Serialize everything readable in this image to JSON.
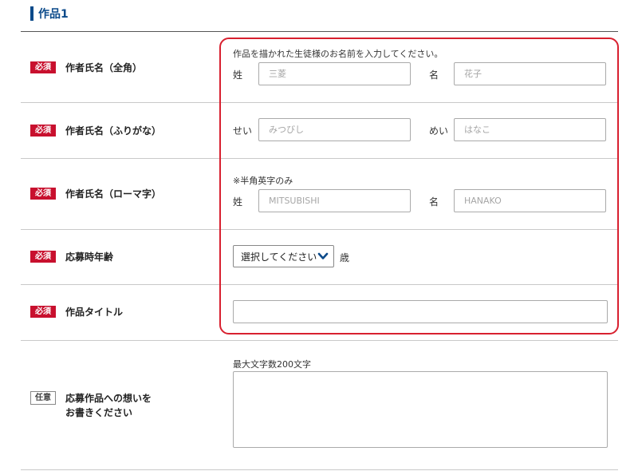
{
  "section": {
    "title": "作品1"
  },
  "rows": {
    "name_kanji": {
      "badge": "必須",
      "label": "作者氏名（全角）",
      "note": "作品を描かれた生徒様のお名前を入力してください。",
      "last_label": "姓",
      "last_placeholder": "三菱",
      "first_label": "名",
      "first_placeholder": "花子"
    },
    "name_kana": {
      "badge": "必須",
      "label": "作者氏名（ふりがな）",
      "last_label": "せい",
      "last_placeholder": "みつびし",
      "first_label": "めい",
      "first_placeholder": "はなこ"
    },
    "name_roman": {
      "badge": "必須",
      "label": "作者氏名（ローマ字）",
      "note": "※半角英字のみ",
      "last_label": "姓",
      "last_placeholder": "MITSUBISHI",
      "first_label": "名",
      "first_placeholder": "HANAKO"
    },
    "age": {
      "badge": "必須",
      "label": "応募時年齢",
      "select_value": "選択してください",
      "unit": "歳"
    },
    "title": {
      "badge": "必須",
      "label": "作品タイトル",
      "value": ""
    },
    "thoughts": {
      "badge": "任意",
      "label_line1": "応募作品への想いを",
      "label_line2": "お書きください",
      "note": "最大文字数200文字",
      "value": ""
    }
  },
  "colors": {
    "required_badge": "#c8102e",
    "highlight_border": "#d8202f",
    "section_accent": "#0b4a8a"
  },
  "icons": {
    "select_arrow": "chevron-down-icon"
  }
}
